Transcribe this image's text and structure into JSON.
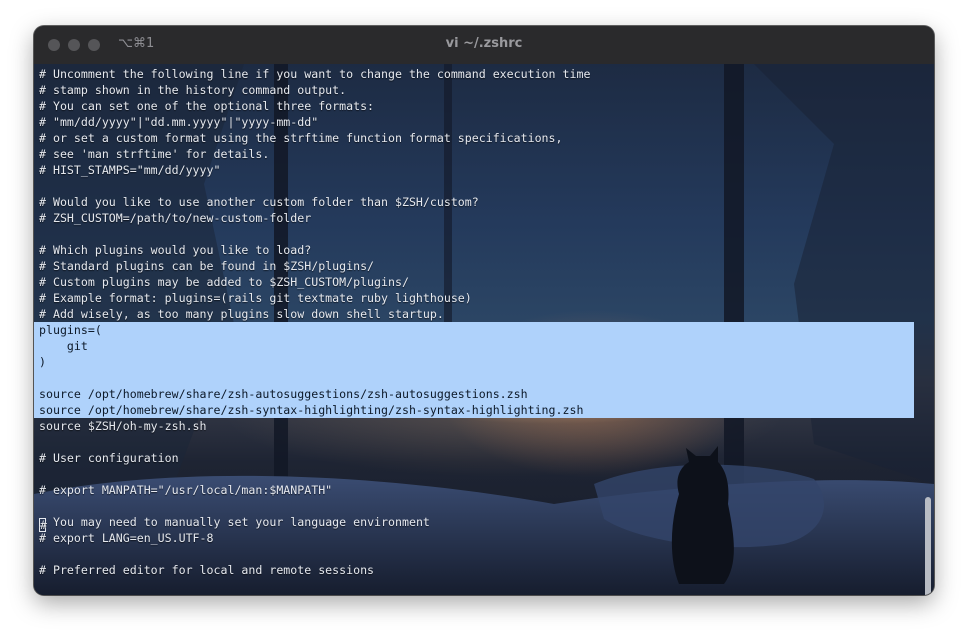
{
  "window": {
    "shortcut": "⌥⌘1",
    "title": "vi ~/.zshrc"
  },
  "editor": {
    "lines": [
      {
        "text": "# Uncomment the following line if you want to change the command execution time",
        "selected": false
      },
      {
        "text": "# stamp shown in the history command output.",
        "selected": false
      },
      {
        "text": "# You can set one of the optional three formats:",
        "selected": false
      },
      {
        "text": "# \"mm/dd/yyyy\"|\"dd.mm.yyyy\"|\"yyyy-mm-dd\"",
        "selected": false
      },
      {
        "text": "# or set a custom format using the strftime function format specifications,",
        "selected": false
      },
      {
        "text": "# see 'man strftime' for details.",
        "selected": false
      },
      {
        "text": "# HIST_STAMPS=\"mm/dd/yyyy\"",
        "selected": false
      },
      {
        "text": "",
        "selected": false
      },
      {
        "text": "# Would you like to use another custom folder than $ZSH/custom?",
        "selected": false
      },
      {
        "text": "# ZSH_CUSTOM=/path/to/new-custom-folder",
        "selected": false
      },
      {
        "text": "",
        "selected": false
      },
      {
        "text": "# Which plugins would you like to load?",
        "selected": false
      },
      {
        "text": "# Standard plugins can be found in $ZSH/plugins/",
        "selected": false
      },
      {
        "text": "# Custom plugins may be added to $ZSH_CUSTOM/plugins/",
        "selected": false
      },
      {
        "text": "# Example format: plugins=(rails git textmate ruby lighthouse)",
        "selected": false
      },
      {
        "text": "# Add wisely, as too many plugins slow down shell startup.",
        "selected": false
      },
      {
        "text": "plugins=(",
        "selected": true
      },
      {
        "text": "    git",
        "selected": true
      },
      {
        "text": ")",
        "selected": true
      },
      {
        "text": "",
        "selected": true
      },
      {
        "text": "source /opt/homebrew/share/zsh-autosuggestions/zsh-autosuggestions.zsh",
        "selected": true
      },
      {
        "text": "source /opt/homebrew/share/zsh-syntax-highlighting/zsh-syntax-highlighting.zsh",
        "selected": true
      },
      {
        "text": "source $ZSH/oh-my-zsh.sh",
        "selected": false
      },
      {
        "text": "",
        "selected": false
      },
      {
        "text": "# User configuration",
        "selected": false
      },
      {
        "text": "",
        "selected": false
      },
      {
        "text": "# export MANPATH=\"/usr/local/man:$MANPATH\"",
        "selected": false
      },
      {
        "text": "",
        "selected": false
      },
      {
        "text": "# You may need to manually set your language environment",
        "selected": false,
        "cursor": true
      },
      {
        "text": "# export LANG=en_US.UTF-8",
        "selected": false
      },
      {
        "text": "",
        "selected": false
      },
      {
        "text": "# Preferred editor for local and remote sessions",
        "selected": false
      }
    ]
  },
  "colors": {
    "selection": "#afd2fb",
    "text": "#e6e9ef",
    "titlebar": "#2a2a2c"
  }
}
